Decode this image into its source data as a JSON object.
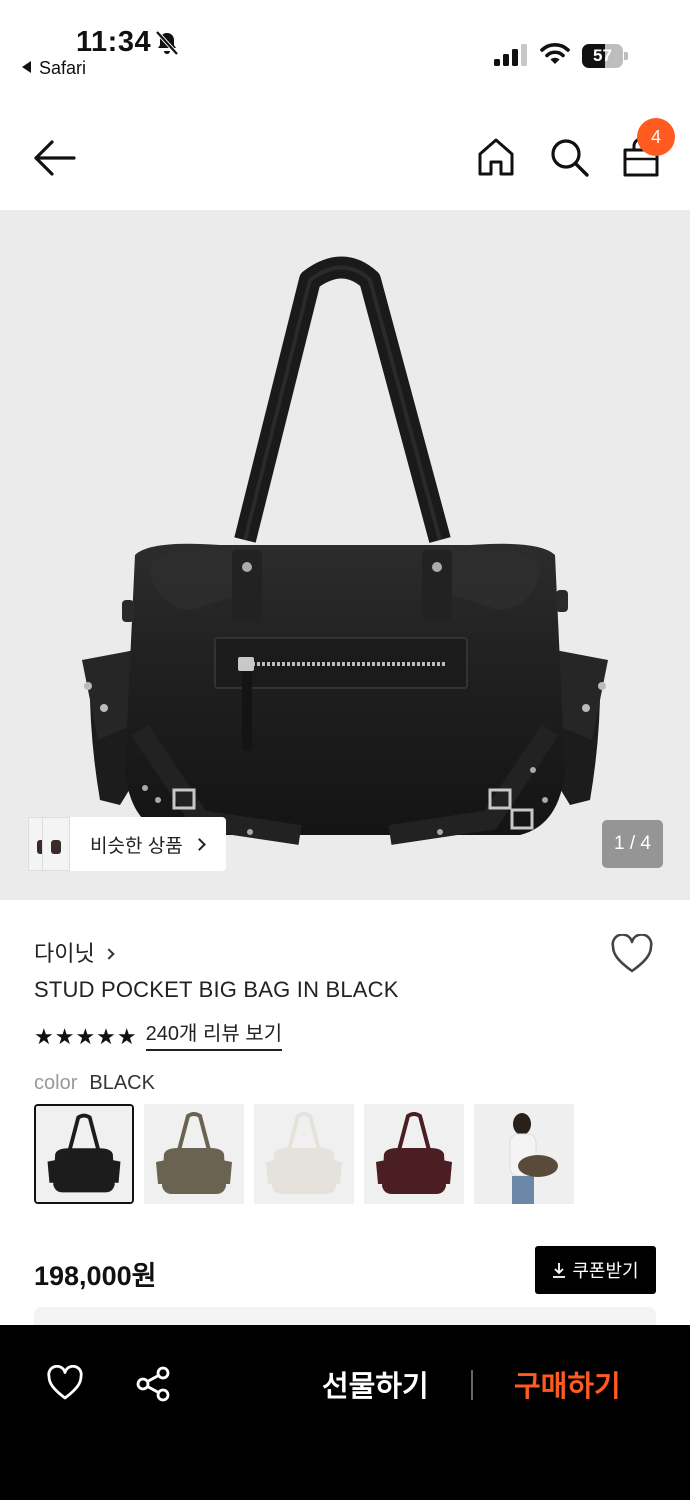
{
  "status_bar": {
    "time": "11:34",
    "back_app": "Safari",
    "battery_level": "57",
    "battery_fraction": 0.57
  },
  "top_nav": {
    "cart_count": "4",
    "icons": [
      "back-arrow-icon",
      "home-icon",
      "search-icon",
      "shopping-bag-icon"
    ]
  },
  "hero": {
    "similar_label": "비슷한 상품",
    "page_counter": "1 / 4",
    "current_page": 1,
    "total_pages": 4,
    "background": "#ebebeb"
  },
  "product": {
    "brand": "다이닛",
    "name": "STUD POCKET BIG BAG IN BLACK",
    "rating_stars": "★★★★★",
    "rating_value": 5,
    "review_link": "240개 리뷰 보기",
    "color_key": "color",
    "color_value": "BLACK",
    "swatches": [
      {
        "name": "black",
        "color": "#1c1c1c",
        "selected": true
      },
      {
        "name": "olive",
        "color": "#6b6352",
        "selected": false
      },
      {
        "name": "ivory",
        "color": "#e4e2da",
        "selected": false
      },
      {
        "name": "burgundy",
        "color": "#4a1e22",
        "selected": false
      },
      {
        "name": "model",
        "color": "#5a4a3a",
        "selected": false
      }
    ],
    "price": "198,000원",
    "coupon_label": "쿠폰받기"
  },
  "bottom_bar": {
    "gift_label": "선물하기",
    "buy_label": "구매하기",
    "accent": "#ff5a1f"
  }
}
